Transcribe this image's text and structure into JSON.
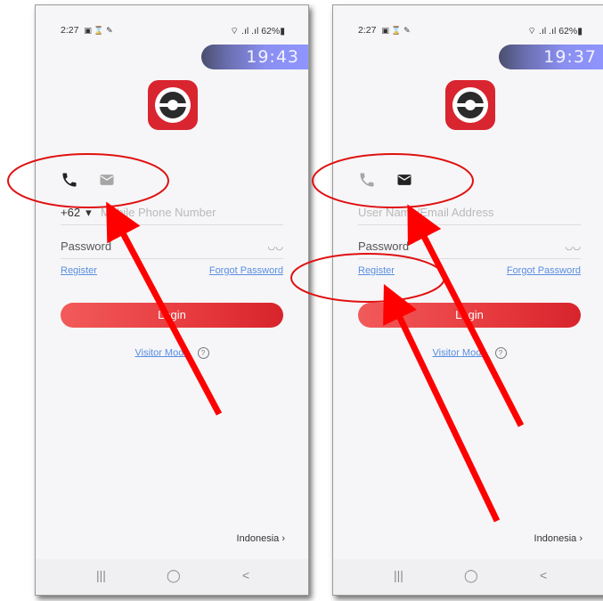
{
  "colors": {
    "brand_red": "#d9252f",
    "link_blue": "#5a8ee0",
    "annotation_red": "#ff0000",
    "clock_gradient": "#8f95ff"
  },
  "screens": [
    {
      "status": {
        "time": "2:27",
        "indicators": "62%"
      },
      "clock": "19:43",
      "account_field": {
        "code": "+62",
        "placeholder": "Mobile Phone Number"
      },
      "password_placeholder": "Password",
      "register": "Register",
      "forgot": "Forgot Password",
      "login": "Login",
      "visitor": "Visitor Mode",
      "region": "Indonesia",
      "active_tab": "phone"
    },
    {
      "status": {
        "time": "2:27",
        "indicators": "62%"
      },
      "clock": "19:37",
      "account_field": {
        "code": "",
        "placeholder": "User Name/Email Address"
      },
      "password_placeholder": "Password",
      "register": "Register",
      "forgot": "Forgot Password",
      "login": "Login",
      "visitor": "Visitor Mode",
      "region": "Indonesia",
      "active_tab": "email"
    }
  ],
  "nav": {
    "recent": "|||",
    "home": "◯",
    "back": "<"
  },
  "icons": [
    "phone-icon",
    "mail-icon",
    "eye-closed-icon",
    "help-icon",
    "chevron-right-icon"
  ]
}
